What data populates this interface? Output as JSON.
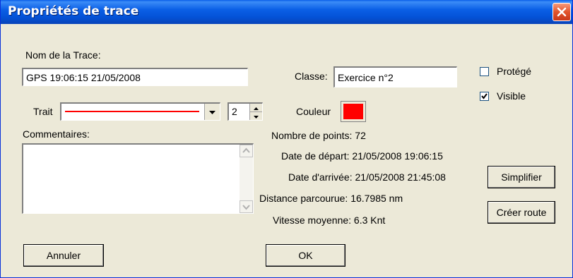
{
  "window": {
    "title": "Propriétés de trace"
  },
  "trace": {
    "name_label": "Nom de la Trace:",
    "name_value": "GPS 19:06:15 21/05/2008",
    "trait_label": "Trait",
    "trait_width": "2",
    "comments_label": "Commentaires:",
    "comments_value": ""
  },
  "classe": {
    "label": "Classe:",
    "value": "Exercice n°2"
  },
  "couleur": {
    "label": "Couleur",
    "color": "#ff0000"
  },
  "options": {
    "protege_label": "Protégé",
    "protege_checked": false,
    "visible_label": "Visible",
    "visible_checked": true
  },
  "stats": {
    "points_label": "Nombre de points:",
    "points_value": "72",
    "depart_label": "Date de départ:",
    "depart_value": "21/05/2008 19:06:15",
    "arrivee_label": "Date d'arrivée:",
    "arrivee_value": "21/05/2008 21:45:08",
    "distance_label": "Distance parcourue:",
    "distance_value": "16.7985 nm",
    "vitesse_label": "Vitesse moyenne:",
    "vitesse_value": "6.3 Knt"
  },
  "buttons": {
    "simplifier": "Simplifier",
    "creer_route": "Créer route",
    "annuler": "Annuler",
    "ok": "OK"
  },
  "colors": {
    "line_color": "#ff0000",
    "titlebar": "#0a5ee8"
  }
}
